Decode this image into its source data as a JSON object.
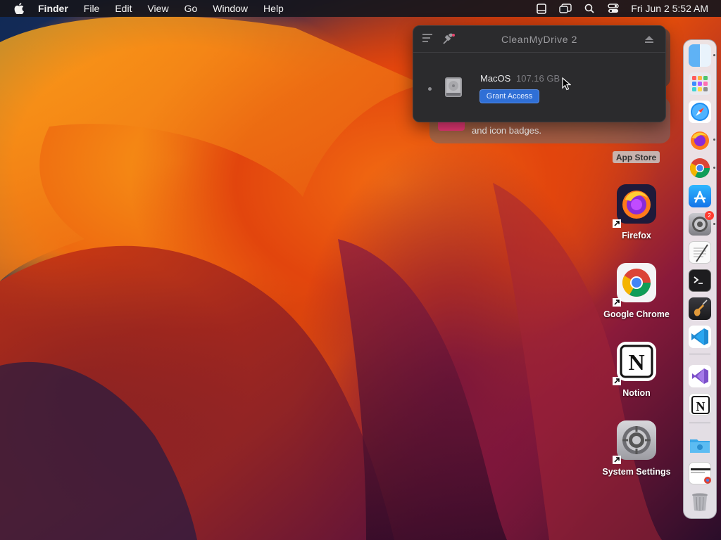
{
  "menubar": {
    "app_name": "Finder",
    "menus": [
      "File",
      "Edit",
      "View",
      "Go",
      "Window",
      "Help"
    ],
    "clock": "Fri Jun 2  5:52 AM",
    "status_icons": [
      "cleanmydrive-icon",
      "stage-manager-icon",
      "search-icon",
      "control-center-icon"
    ]
  },
  "popover": {
    "title": "CleanMyDrive 2",
    "drive": {
      "name": "MacOS",
      "size": "107.16 GB",
      "button": "Grant Access"
    }
  },
  "notification": {
    "text": "and icon badges."
  },
  "desktop_icons": [
    {
      "label": "App Store"
    },
    {
      "label": "Firefox"
    },
    {
      "label": "Google Chrome"
    },
    {
      "label": "Notion"
    },
    {
      "label": "System Settings"
    }
  ],
  "dock": {
    "items": [
      "finder-icon",
      "launchpad-icon",
      "safari-icon",
      "firefox-icon",
      "chrome-icon",
      "app-store-icon",
      "system-settings-icon",
      "textedit-icon",
      "terminal-icon",
      "instruments-icon",
      "vscode-icon",
      "visual-studio-icon",
      "notion-icon",
      "downloads-folder-icon",
      "recent-document-icon",
      "trash-icon"
    ],
    "settings_badge": "2"
  }
}
